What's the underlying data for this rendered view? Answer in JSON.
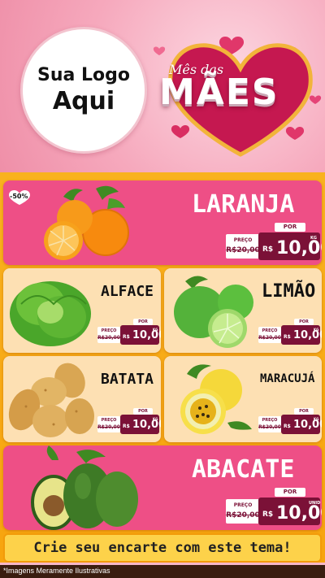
{
  "header": {
    "logo_line1": "Sua Logo",
    "logo_line2": "Aqui",
    "title_small": "Mês das",
    "title_big": "MÃES"
  },
  "discount_badge": "-50%",
  "products": [
    {
      "name": "LARANJA",
      "label_before": "PREÇO",
      "old_price": "R$20,00",
      "label_por": "POR",
      "currency": "R$",
      "price": "10,00",
      "unit": "KG"
    },
    {
      "name": "ALFACE",
      "label_before": "PREÇO",
      "old_price": "R$20,00",
      "label_por": "POR",
      "currency": "R$",
      "price": "10,00",
      "unit": "KG"
    },
    {
      "name": "LIMÃO",
      "label_before": "PREÇO",
      "old_price": "R$20,00",
      "label_por": "POR",
      "currency": "R$",
      "price": "10,00",
      "unit": "KG"
    },
    {
      "name": "BATATA",
      "label_before": "PREÇO",
      "old_price": "R$20,00",
      "label_por": "POR",
      "currency": "R$",
      "price": "10,00",
      "unit": "KG"
    },
    {
      "name": "MARACUJÁ",
      "label_before": "PREÇO",
      "old_price": "R$20,00",
      "label_por": "POR",
      "currency": "R$",
      "price": "10,00",
      "unit": "KG"
    },
    {
      "name": "ABACATE",
      "label_before": "PREÇO",
      "old_price": "R$20,00",
      "label_por": "POR",
      "currency": "R$",
      "price": "10,00",
      "unit": "UNID"
    }
  ],
  "cta": "Crie seu encarte com este tema!",
  "footer": "*Imagens Meramente Ilustrativas",
  "colors": {
    "pink": "#ee4f86",
    "peach": "#fde0b3",
    "orange": "#f9b21e",
    "price_bg": "#7b1137"
  }
}
